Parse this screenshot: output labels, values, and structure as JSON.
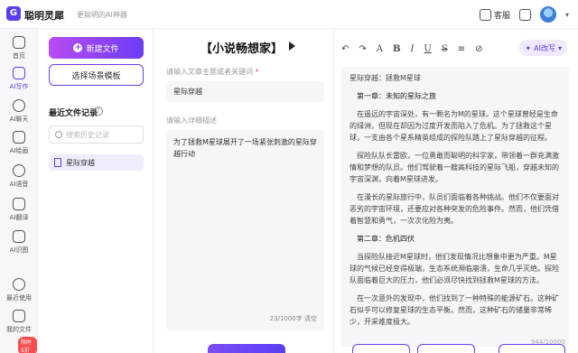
{
  "app": {
    "name": "聪明灵犀",
    "slogan": "更聪明的AI神器",
    "logo_glyph": "G"
  },
  "topbar": {
    "service_label": "客服"
  },
  "nav": {
    "items": [
      {
        "label": "首页",
        "icon": "home-icon"
      },
      {
        "label": "AI写作",
        "icon": "pen-icon"
      },
      {
        "label": "AI聊天",
        "icon": "chat-icon"
      },
      {
        "label": "AI绘画",
        "icon": "paint-icon"
      },
      {
        "label": "AI语音",
        "icon": "voice-icon"
      },
      {
        "label": "AI翻译",
        "icon": "translate-icon"
      },
      {
        "label": "AI识图",
        "icon": "image-icon"
      },
      {
        "label": "最近使用",
        "icon": "clock-icon"
      },
      {
        "label": "我的文件",
        "icon": "folder-icon"
      }
    ],
    "vip_badge": "限时5折"
  },
  "leftpanel": {
    "new_file_label": "新建文件",
    "choose_template_label": "选择场景模板",
    "recent_title": "最近文件记录",
    "search_placeholder": "搜索历史记录",
    "recent_files": [
      {
        "name": "星际穿越"
      }
    ]
  },
  "form": {
    "title": "【小说畅想家】",
    "topic_label": "请输入文章主题或者关键词",
    "topic_value": "星际穿越",
    "desc_label": "请输入详细描述",
    "desc_value": "为了拯救M星球展开了一场紧张刺激的星际穿越行动",
    "counter": "23/1000字",
    "clear_label": "清空"
  },
  "editor": {
    "toolbar": {
      "undo": "↶",
      "redo": "↷",
      "font": "A",
      "bold": "B",
      "italic": "I",
      "underline": "U",
      "strike": "S",
      "list": "≡",
      "link": "⊘",
      "ai_label": "AI改写"
    },
    "paragraphs": [
      {
        "text": "星际穿越：拯救M星球",
        "indent": false
      },
      {
        "text": "第一章：未知的星际之旅",
        "indent": true
      },
      {
        "text": "在遥远的宇宙深处，有一颗名为M的星球。这个星球曾经是生命的绿洲，但现在却因为过度开发而陷入了危机。为了拯救这个星球，一支由各个星系精英组成的探险队踏上了星际穿越的征程。",
        "indent": true
      },
      {
        "text": "探险队队长雷欧，一位勇敢而聪明的科学家，带领着一群充满激情和梦想的队员。他们驾驶着一艘高科技的星际飞船，穿越未知的宇宙深渊，向着M星球进发。",
        "indent": true
      },
      {
        "text": "在漫长的星际旅行中，队员们面临着各种挑战。他们不仅要面对恶劣的宇宙环境，还要应对各种突发的危险事件。然而，他们凭借着智慧和勇气，一次次化险为夷。",
        "indent": true
      },
      {
        "text": "第二章：危机四伏",
        "indent": true
      },
      {
        "text": "当探险队接近M星球时，他们发现情况比想象中更为严重。M星球的气候已经变得极端，生态系统濒临崩溃，生命几乎灭绝。探险队面临着巨大的压力，他们必须尽快找到拯救M星球的方法。",
        "indent": true
      },
      {
        "text": "在一次意外的发现中，他们找到了一种特殊的能源矿石。这种矿石似乎可以修复星球的生态平衡。然而，这种矿石的储量非常稀少，开采难度极大。",
        "indent": true
      }
    ],
    "counter": "944/10000"
  }
}
